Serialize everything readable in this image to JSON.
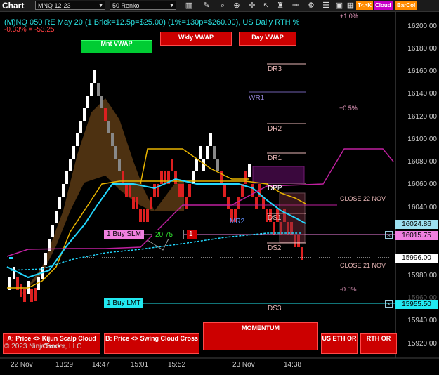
{
  "toolbar": {
    "app_title": "Chart",
    "instrument": "MNQ 12-23",
    "interval": "50 Renko",
    "icons": [
      "bars-icon",
      "draw-pen-icon",
      "search-icon",
      "zoom-in-icon",
      "zoom-out-icon",
      "crosshair-icon",
      "pointer-icon",
      "strategy-icon",
      "drawing-tools-icon",
      "indicators-icon",
      "properties-icon",
      "data-box-icon",
      "grid-icon"
    ],
    "buttons": [
      {
        "label": "T<>K",
        "color": "#ff8c00"
      },
      {
        "label": "Cloud",
        "color": "#c800c8"
      },
      {
        "label": "BarCol",
        "color": "#ff8c00"
      }
    ]
  },
  "header": {
    "title": "(M)NQ 050 RE May 20 (1 Brick=12.5p=$25.00) (1%=130p=$260.00), US Daily RTH %",
    "subtitle": "-0.33% = -53.25"
  },
  "vwap_buttons": {
    "monthly": "Mnt VWAP",
    "weekly": "Wkly VWAP",
    "daily": "Day VWAP"
  },
  "levels": {
    "plus_1pct": "+1.0%",
    "plus_05pct": "+0.5%",
    "minus_05pct": "-0.5%",
    "dr3": "DR3",
    "wr1": "WR1",
    "dr2": "DR2",
    "dr1": "DR1",
    "dpp": "DPP",
    "close_22": "CLOSE 22 NOV",
    "mr2": "MR2",
    "ds1": "DS1",
    "ds2": "DS2",
    "close_21": "CLOSE 21 NOV",
    "ds3": "DS3"
  },
  "orders": {
    "buy_slm_label": "1 Buy SLM",
    "buy_slm_value": "20.75",
    "buy_slm_qty": "1",
    "buy_lmt_label": "1 Buy LMT",
    "close_icon": "×"
  },
  "price_axis": {
    "ticks": [
      "16200.00",
      "16180.00",
      "16160.00",
      "16140.00",
      "16120.00",
      "16100.00",
      "16080.00",
      "16060.00",
      "16040.00",
      "15980.00",
      "15960.00",
      "15940.00",
      "15920.00"
    ],
    "boxes": {
      "last": "16024.86",
      "slm": "16015.75",
      "close21": "15996.00",
      "lmt": "15955.50"
    }
  },
  "time_axis": [
    "22 Nov",
    "13:29",
    "14:47",
    "15:01",
    "15:52",
    "23 Nov",
    "14:38"
  ],
  "bottom_buttons": {
    "kijun": "A: Price <> Kijun Scalp Cloud Cross",
    "swing": "B: Price <> Swing Cloud Cross",
    "momentum": "MOMENTUM",
    "us_eth": "US ETH OR",
    "rth": "RTH OR"
  },
  "copyright": "© 2023 NinjaTrader, LLC",
  "colors": {
    "up_brick": "#ffffff",
    "down_brick": "#dd2020",
    "cyan_line": "#22d8ff",
    "gold_line": "#e8b400",
    "magenta_line": "#c020a0",
    "price_axis_text": "#cccccc"
  }
}
